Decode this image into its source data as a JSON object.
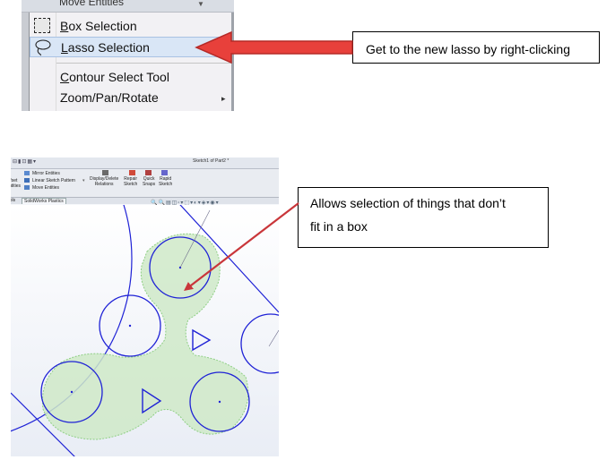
{
  "menu": {
    "partial_top_item": "Move Entities",
    "items": [
      {
        "label": "Box Selection",
        "accel": "B",
        "rest": "ox Selection",
        "icon": "box-select-icon"
      },
      {
        "label": "Lasso Selection",
        "accel": "L",
        "rest": "asso Selection",
        "icon": "lasso-icon",
        "highlighted": true
      },
      {
        "label": "Contour Select Tool",
        "accel": "C",
        "rest": "ontour Select Tool"
      },
      {
        "label": "Zoom/Pan/Rotate",
        "has_submenu": true
      }
    ],
    "submenu_arrow": "▸"
  },
  "callouts": {
    "top": "Get to the new lasso by right-clicking",
    "bottom_line1": "Allows selection of things that don’t",
    "bottom_line2": "fit in a box"
  },
  "sketch": {
    "window_title": "Sketch1 of Part2 *",
    "ribbon": {
      "mirror": "Mirror Entities",
      "linear_pattern": "Linear Sketch Pattern",
      "move": "Move Entities",
      "offset_line1": "ffset",
      "offset_line2": "ntities",
      "display_delete_1": "Display/Delete",
      "display_delete_2": "Relations",
      "repair_1": "Repair",
      "repair_2": "Sketch",
      "quick_1": "Quick",
      "quick_2": "Snaps",
      "rapid_1": "Rapid",
      "rapid_2": "Sketch"
    },
    "tabs": [
      "ools",
      "SolidWorks Plastics"
    ]
  },
  "colors": {
    "arrow_red": "#e8403b",
    "arrow_red_dark": "#b52a27",
    "sketch_blue": "#1f22d6",
    "lasso_fill": "#cfe9c8",
    "lasso_edge": "#8fcf84"
  }
}
